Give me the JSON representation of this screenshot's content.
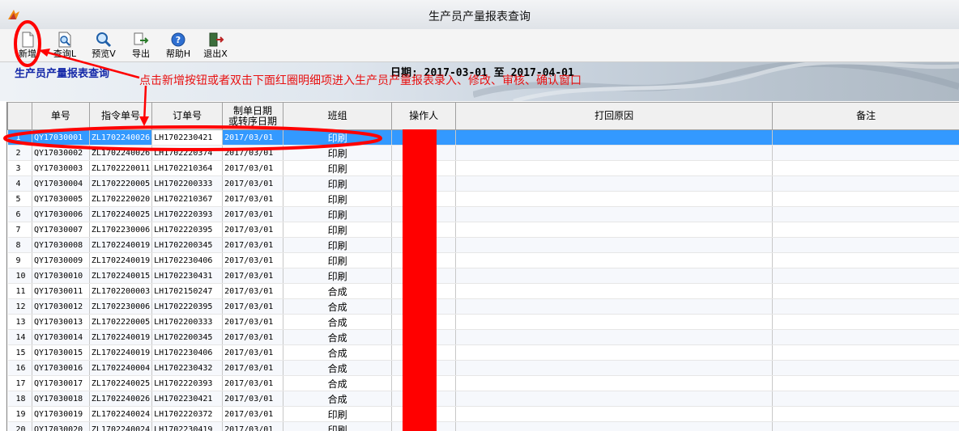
{
  "window": {
    "title": "生产员产量报表查询"
  },
  "toolbar": {
    "buttons": [
      {
        "label": "新增",
        "icon": "new-document-icon"
      },
      {
        "label": "查询L",
        "icon": "preview-document-icon"
      },
      {
        "label": "预览V",
        "icon": "magnifier-icon"
      },
      {
        "label": "导出",
        "icon": "export-icon"
      },
      {
        "label": "帮助H",
        "icon": "help-icon"
      },
      {
        "label": "退出X",
        "icon": "exit-door-icon"
      }
    ]
  },
  "banner": {
    "title": "生产员产量报表查询",
    "date_text": "日期: 2017-03-01 至 2017-04-01"
  },
  "annotation": {
    "text": "点击新增按钮或者双击下面红圈明细项进入生产员产量报表录入、修改、审核、确认窗口"
  },
  "table": {
    "headers": [
      "",
      "单号",
      "指令单号",
      "订单号",
      "制单日期\n或转序日期",
      "班组",
      "操作人",
      "打回原因",
      "备注"
    ],
    "rows": [
      [
        "1",
        "QY17030001",
        "ZL1702240026",
        "LH1702230421",
        "2017/03/01",
        "印刷",
        "",
        "",
        ""
      ],
      [
        "2",
        "QY17030002",
        "ZL1702240026",
        "LH1702220374",
        "2017/03/01",
        "印刷",
        "",
        "",
        ""
      ],
      [
        "3",
        "QY17030003",
        "ZL1702220011",
        "LH1702210364",
        "2017/03/01",
        "印刷",
        "",
        "",
        ""
      ],
      [
        "4",
        "QY17030004",
        "ZL1702220005",
        "LH1702200333",
        "2017/03/01",
        "印刷",
        "",
        "",
        ""
      ],
      [
        "5",
        "QY17030005",
        "ZL1702220020",
        "LH1702210367",
        "2017/03/01",
        "印刷",
        "",
        "",
        ""
      ],
      [
        "6",
        "QY17030006",
        "ZL1702240025",
        "LH1702220393",
        "2017/03/01",
        "印刷",
        "",
        "",
        ""
      ],
      [
        "7",
        "QY17030007",
        "ZL1702230006",
        "LH1702220395",
        "2017/03/01",
        "印刷",
        "",
        "",
        ""
      ],
      [
        "8",
        "QY17030008",
        "ZL1702240019",
        "LH1702200345",
        "2017/03/01",
        "印刷",
        "",
        "",
        ""
      ],
      [
        "9",
        "QY17030009",
        "ZL1702240019",
        "LH1702230406",
        "2017/03/01",
        "印刷",
        "",
        "",
        ""
      ],
      [
        "10",
        "QY17030010",
        "ZL1702240015",
        "LH1702230431",
        "2017/03/01",
        "印刷",
        "",
        "",
        ""
      ],
      [
        "11",
        "QY17030011",
        "ZL1702200003",
        "LH1702150247",
        "2017/03/01",
        "合成",
        "",
        "",
        ""
      ],
      [
        "12",
        "QY17030012",
        "ZL1702230006",
        "LH1702220395",
        "2017/03/01",
        "合成",
        "",
        "",
        ""
      ],
      [
        "13",
        "QY17030013",
        "ZL1702220005",
        "LH1702200333",
        "2017/03/01",
        "合成",
        "",
        "",
        ""
      ],
      [
        "14",
        "QY17030014",
        "ZL1702240019",
        "LH1702200345",
        "2017/03/01",
        "合成",
        "",
        "",
        ""
      ],
      [
        "15",
        "QY17030015",
        "ZL1702240019",
        "LH1702230406",
        "2017/03/01",
        "合成",
        "",
        "",
        ""
      ],
      [
        "16",
        "QY17030016",
        "ZL1702240004",
        "LH1702230432",
        "2017/03/01",
        "合成",
        "",
        "",
        ""
      ],
      [
        "17",
        "QY17030017",
        "ZL1702240025",
        "LH1702220393",
        "2017/03/01",
        "合成",
        "",
        "",
        ""
      ],
      [
        "18",
        "QY17030018",
        "ZL1702240026",
        "LH1702230421",
        "2017/03/01",
        "合成",
        "",
        "",
        ""
      ],
      [
        "19",
        "QY17030019",
        "ZL1702240024",
        "LH1702220372",
        "2017/03/01",
        "印刷",
        "",
        "",
        ""
      ],
      [
        "20",
        "QY17030020",
        "ZL1702240024",
        "LH1702230419",
        "2017/03/01",
        "印刷",
        "",
        "",
        ""
      ]
    ]
  },
  "colors": {
    "annotation_red": "#e81010",
    "selection_blue": "#3399ff",
    "banner_title_blue": "#1428a8"
  }
}
